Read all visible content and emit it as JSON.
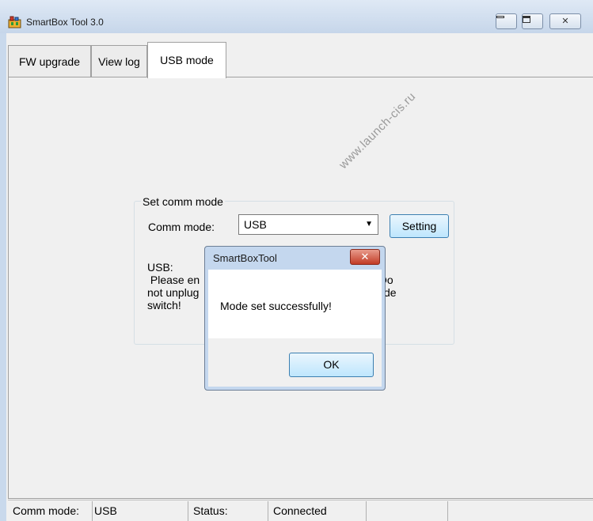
{
  "window": {
    "title": "SmartBox Tool 3.0",
    "watermark": "www.launch-cis.ru",
    "buttons": {
      "minimize": "minimize",
      "maximize": "maximize",
      "close": "close"
    }
  },
  "tabs": [
    {
      "label": "FW upgrade"
    },
    {
      "label": "View log"
    },
    {
      "label": "USB mode",
      "active": true
    }
  ],
  "group": {
    "title": "Set comm mode",
    "comm_mode_label": "Comm mode:",
    "comm_mode_value": "USB",
    "setting_button": "Setting",
    "usb_info_line1": "USB:",
    "usb_info_line2": " Please en",
    "usb_info_line2_tail": "! Do",
    "usb_info_line3": "not unplug",
    "usb_info_line3_tail": "de",
    "usb_info_line4": "switch!"
  },
  "dialog": {
    "title": "SmartBoxTool",
    "close_glyph": "✕",
    "message": "Mode set successfully!",
    "ok_button": "OK"
  },
  "statusbar": {
    "comm_mode_label": "Comm mode:",
    "comm_mode_value": "USB",
    "status_label": "Status:",
    "status_value": "Connected"
  },
  "colors": {
    "accent_button": "#bee6fd",
    "dialog_close": "#c23c26",
    "frame": "#c9d9ec"
  }
}
